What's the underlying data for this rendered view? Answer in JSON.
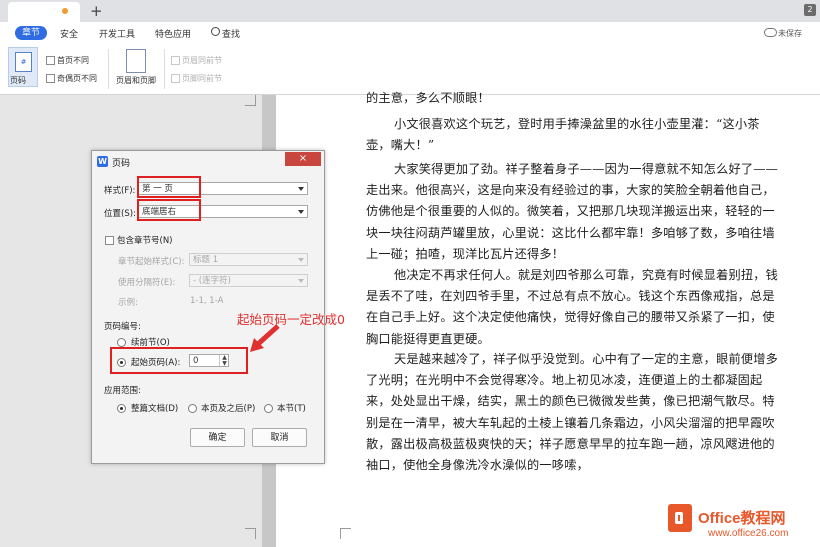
{
  "tabs": {
    "plus": "+",
    "count": "2"
  },
  "menu": {
    "items": [
      "章节",
      "安全",
      "开发工具",
      "特色应用",
      "查找"
    ],
    "unsaved": "未保存"
  },
  "ribbon": {
    "page_number": "页码",
    "first_page_diff": "首页不同",
    "odd_even_diff": "奇偶页不同",
    "header_footer": "页眉和页脚",
    "header_same_prev": "页眉同前节",
    "footer_same_prev": "页脚同前节"
  },
  "document": {
    "top_line": "的主意，多么不顺眼！",
    "paragraphs": [
      "小文很喜欢这个玩艺，登时用手捧澡盆里的水往小壶里灌：“这小茶壶，嘴大！”",
      "大家笑得更加了劲。祥子整着身子——因为一得意就不知怎么好了——走出来。他很高兴，这是向来没有经验过的事，大家的笑脸全朝着他自己，仿佛他是个很重要的人似的。微笑着，又把那几块现洋搬运出来，轻轻的一块一块往闷葫芦罐里放，心里说：这比什么都牢靠！多咱够了数，多咱往墙上一碰；拍喳，现洋比瓦片还得多！",
      "他决定不再求任何人。就是刘四爷那么可靠，究竟有时候显着别扭，钱是丢不了哇，在刘四爷手里，不过总有点不放心。钱这个东西像戒指，总是在自己手上好。这个决定使他痛快，觉得好像自己的腰带又杀紧了一扣，使胸口能挺得更直更硬。",
      "天是越来越冷了，祥子似乎没觉到。心中有了一定的主意，眼前便增多了光明；在光明中不会觉得寒冷。地上初见冰凌，连便道上的土都凝固起来，处处显出干燥，结实，黑土的颜色已微微发些黄，像已把潮气散尽。特别是在一清早，被大车轧起的土棱上镶着几条霜边，小风尖溜溜的把早霞吹散，露出极高极蓝极爽快的天；祥子愿意早早的拉车跑一趟，凉风飕进他的袖口，使他全身像洗冷水澡似的一哆嗦，"
    ]
  },
  "dialog": {
    "title": "页码",
    "close": "×",
    "style_label": "样式(F):",
    "style_value": "第 一 页",
    "position_label": "位置(S):",
    "position_value": "底端居右",
    "include_chapter": "包含章节号(N)",
    "chapter_start_label": "章节起始样式(C):",
    "chapter_start_value": "标题 1",
    "separator_label": "使用分隔符(E):",
    "separator_value": "-    (连字符)",
    "example_label": "示例:",
    "example_value": "1-1, 1-A",
    "numbering_title": "页码编号:",
    "continue_prev": "续前节(O)",
    "start_at_label": "起始页码(A):",
    "start_at_value": "0",
    "scope_title": "应用范围:",
    "whole_doc": "整篇文档(D)",
    "this_page_after": "本页及之后(P)",
    "this_section": "本节(T)",
    "ok": "确定",
    "cancel": "取消"
  },
  "annotation": "起始页码一定改成0",
  "logo": {
    "name": "Office教程网",
    "url": "www.office26.com"
  },
  "colors": {
    "accent": "#2f6ce1",
    "annotation": "#e03030",
    "logo": "#e8582a"
  }
}
